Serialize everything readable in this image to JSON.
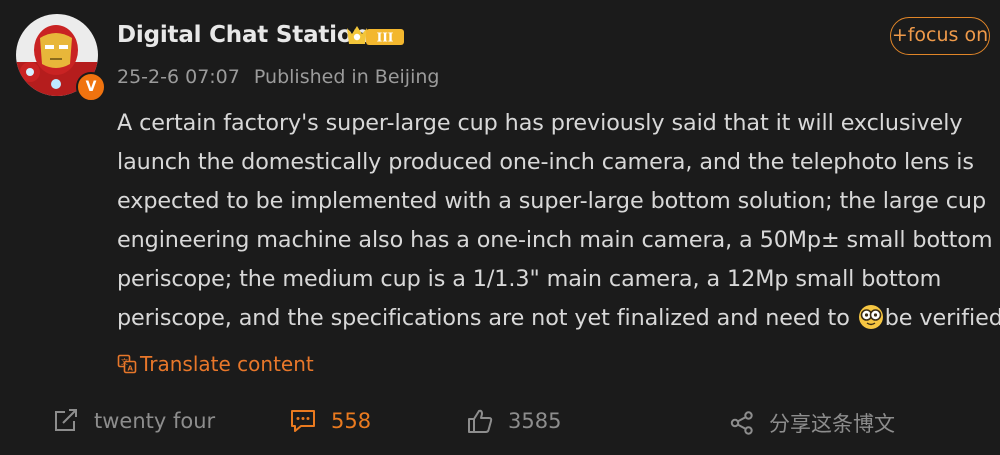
{
  "author": {
    "name": "Digital Chat Station",
    "rank_badge": "III",
    "verified_badge": "V"
  },
  "meta": {
    "date": "25-2-6 07:07",
    "location": "Published in Beijing"
  },
  "follow_label": "+focus on",
  "post": {
    "lines": [
      "A certain factory's super-large cup has previously said that it will exclusively",
      "launch the domestically produced one-inch camera, and the telephoto lens is",
      "expected to be implemented with a super-large bottom solution; the large cup",
      "engineering machine also has a one-inch main camera, a 50Mp± small bottom",
      "periscope; the medium cup is a 1/1.3\" main camera, a 12Mp small bottom"
    ],
    "last_line_before_emoji": "periscope, and the specifications are not yet finalized and need to ",
    "last_line_after_emoji": "be verified"
  },
  "translate_label": "Translate content",
  "actions": {
    "repost": "twenty four",
    "comments": "558",
    "likes": "3585",
    "share": "分享这条博文"
  },
  "colors": {
    "background": "#1b1b1b",
    "accent": "#e8772a",
    "text": "#d8d8d8",
    "muted": "#9b9b9b"
  }
}
